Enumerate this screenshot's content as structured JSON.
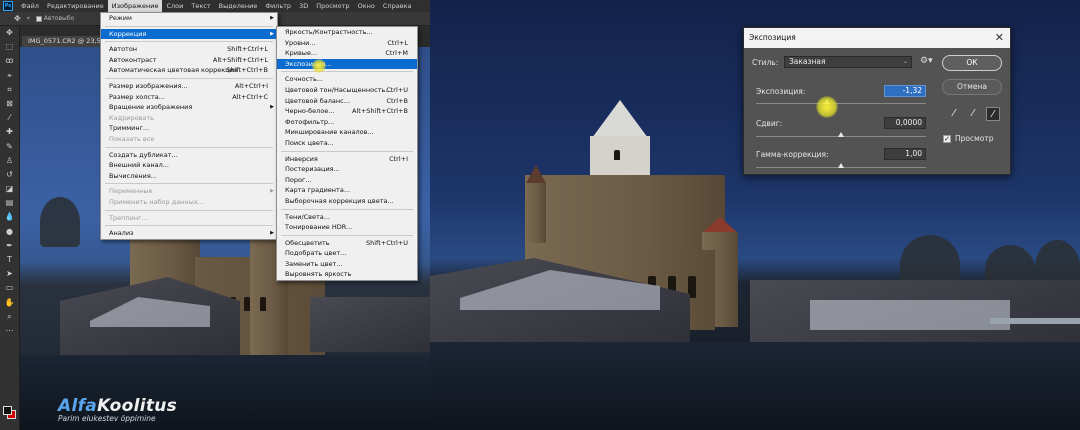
{
  "menubar": {
    "items": [
      "Файл",
      "Редактирование",
      "Изображение",
      "Слои",
      "Текст",
      "Выделение",
      "Фильтр",
      "3D",
      "Просмотр",
      "Окно",
      "Справка"
    ],
    "active_index": 2,
    "logo": "Ps"
  },
  "options_bar": {
    "move_icon": "move-tool-icon",
    "auto_label": "Автовыбо"
  },
  "document": {
    "tab_title": "IMG_0571.CR2 @ 23,5% ("
  },
  "image_menu": {
    "items": [
      {
        "label": "Режим",
        "shortcut": "",
        "submenu": true,
        "state": "normal"
      },
      {
        "sep": true
      },
      {
        "label": "Коррекция",
        "shortcut": "",
        "submenu": true,
        "state": "selected"
      },
      {
        "sep": true
      },
      {
        "label": "Автотон",
        "shortcut": "Shift+Ctrl+L",
        "state": "normal"
      },
      {
        "label": "Автоконтраст",
        "shortcut": "Alt+Shift+Ctrl+L",
        "state": "normal"
      },
      {
        "label": "Автоматическая цветовая коррекция",
        "shortcut": "Shift+Ctrl+B",
        "state": "normal"
      },
      {
        "sep": true
      },
      {
        "label": "Размер изображения...",
        "shortcut": "Alt+Ctrl+I",
        "state": "normal"
      },
      {
        "label": "Размер холста...",
        "shortcut": "Alt+Ctrl+C",
        "state": "normal"
      },
      {
        "label": "Вращение изображения",
        "shortcut": "",
        "submenu": true,
        "state": "normal"
      },
      {
        "label": "Кадрировать",
        "shortcut": "",
        "state": "disabled"
      },
      {
        "label": "Тримминг...",
        "shortcut": "",
        "state": "normal"
      },
      {
        "label": "Показать все",
        "shortcut": "",
        "state": "disabled"
      },
      {
        "sep": true
      },
      {
        "label": "Создать дубликат...",
        "shortcut": "",
        "state": "normal"
      },
      {
        "label": "Внешний канал...",
        "shortcut": "",
        "state": "normal"
      },
      {
        "label": "Вычисления...",
        "shortcut": "",
        "state": "normal"
      },
      {
        "sep": true
      },
      {
        "label": "Переменные",
        "shortcut": "",
        "submenu": true,
        "state": "disabled"
      },
      {
        "label": "Применить набор данных...",
        "shortcut": "",
        "state": "disabled"
      },
      {
        "sep": true
      },
      {
        "label": "Треппинг...",
        "shortcut": "",
        "state": "disabled"
      },
      {
        "sep": true
      },
      {
        "label": "Анализ",
        "shortcut": "",
        "submenu": true,
        "state": "normal"
      }
    ]
  },
  "adjust_menu": {
    "items": [
      {
        "label": "Яркость/Контрастность...",
        "shortcut": "",
        "state": "normal"
      },
      {
        "label": "Уровни...",
        "shortcut": "Ctrl+L",
        "state": "normal"
      },
      {
        "label": "Кривые...",
        "shortcut": "Ctrl+M",
        "state": "normal"
      },
      {
        "label": "Экспозиция...",
        "shortcut": "",
        "state": "selected"
      },
      {
        "sep": true
      },
      {
        "label": "Сочность...",
        "shortcut": "",
        "state": "normal"
      },
      {
        "label": "Цветовой тон/Насыщенность...",
        "shortcut": "Ctrl+U",
        "state": "normal"
      },
      {
        "label": "Цветовой баланс...",
        "shortcut": "Ctrl+B",
        "state": "normal"
      },
      {
        "label": "Черно-белое...",
        "shortcut": "Alt+Shift+Ctrl+B",
        "state": "normal"
      },
      {
        "label": "Фотофильтр...",
        "shortcut": "",
        "state": "normal"
      },
      {
        "label": "Микширование каналов...",
        "shortcut": "",
        "state": "normal"
      },
      {
        "label": "Поиск цвета...",
        "shortcut": "",
        "state": "normal"
      },
      {
        "sep": true
      },
      {
        "label": "Инверсия",
        "shortcut": "Ctrl+I",
        "state": "normal"
      },
      {
        "label": "Постеризация...",
        "shortcut": "",
        "state": "normal"
      },
      {
        "label": "Порог...",
        "shortcut": "",
        "state": "normal"
      },
      {
        "label": "Карта градиента...",
        "shortcut": "",
        "state": "normal"
      },
      {
        "label": "Выборочная коррекция цвета...",
        "shortcut": "",
        "state": "normal"
      },
      {
        "sep": true
      },
      {
        "label": "Тени/Света...",
        "shortcut": "",
        "state": "normal"
      },
      {
        "label": "Тонирование HDR...",
        "shortcut": "",
        "state": "normal"
      },
      {
        "sep": true
      },
      {
        "label": "Обесцветить",
        "shortcut": "Shift+Ctrl+U",
        "state": "normal"
      },
      {
        "label": "Подобрать цвет...",
        "shortcut": "",
        "state": "normal"
      },
      {
        "label": "Заменить цвет...",
        "shortcut": "",
        "state": "normal"
      },
      {
        "label": "Выровнять яркость",
        "shortcut": "",
        "state": "normal"
      }
    ]
  },
  "exposure_dialog": {
    "title": "Экспозиция",
    "preset_label": "Стиль:",
    "preset_value": "Заказная",
    "ok_label": "ОК",
    "cancel_label": "Отмена",
    "exposure_label": "Экспозиция:",
    "exposure_value": "-1,32",
    "exposure_fraction": 0.42,
    "offset_label": "Сдвиг:",
    "offset_value": "0,0000",
    "offset_fraction": 0.5,
    "gamma_label": "Гамма-коррекция:",
    "gamma_value": "1,00",
    "gamma_fraction": 0.5,
    "preview_label": "Просмотр",
    "preview_checked": true,
    "pickers": [
      "black-eyedropper-icon",
      "gray-eyedropper-icon",
      "white-eyedropper-icon"
    ]
  },
  "watermark": {
    "brand_a": "Alfa",
    "brand_b": "Koolitus",
    "tagline": "Parim elukestev õppimine"
  },
  "colors": {
    "menu_selected": "#0a6ccf",
    "foreground_swatch": "#111111",
    "background_swatch": "#d10000",
    "brand_blue": "#5aa6ee"
  }
}
